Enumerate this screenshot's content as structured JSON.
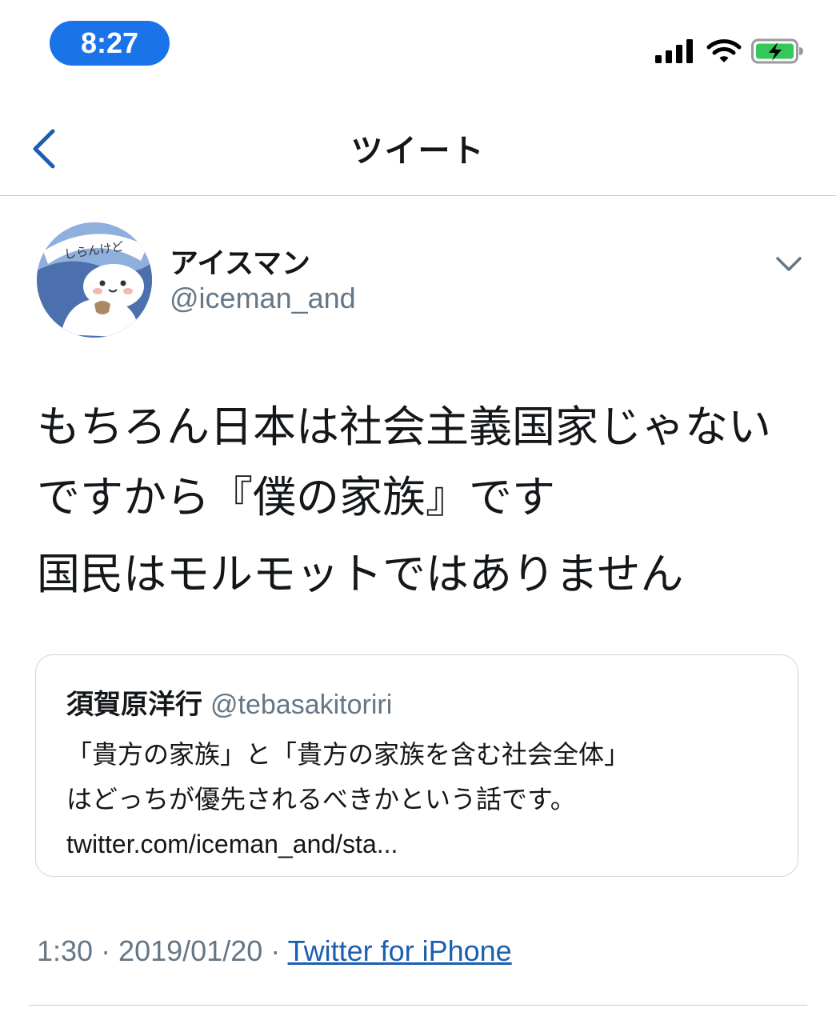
{
  "status_bar": {
    "time": "8:27",
    "icons": [
      "signal-icon",
      "wifi-icon",
      "battery-charging-icon"
    ],
    "accent": "#1a73e8"
  },
  "header": {
    "title": "ツイート",
    "back_icon": "chevron-left-icon"
  },
  "tweet": {
    "author": {
      "display_name": "アイスマン",
      "handle": "@iceman_and",
      "avatar_badge_text": "しらんけど"
    },
    "text_lines": [
      "もちろん日本は社会主義国家じゃないですから『僕の家族』です",
      "国民はモルモットではありません"
    ],
    "quoted": {
      "display_name": "須賀原洋行",
      "handle": "@tebasakitoriri",
      "lines": [
        "「貴方の家族」と「貴方の家族を含む社会全体」",
        "はどっちが優先されるべきかという話です。",
        "twitter.com/iceman_and/sta..."
      ]
    },
    "timestamp": "1:30 · 2019/01/20 · ",
    "source": "Twitter for iPhone"
  }
}
